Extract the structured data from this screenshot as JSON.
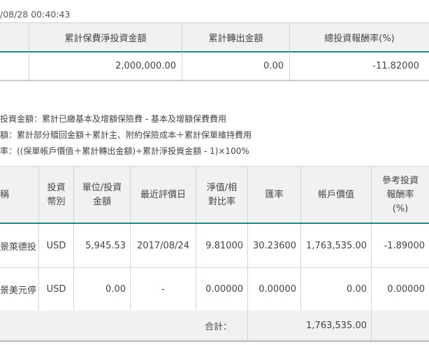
{
  "timestamp": "/08/28 00:40:43",
  "summary": {
    "headers": [
      "",
      "累計保費淨投資金額",
      "累計轉出金額",
      "總投資報酬率(%)"
    ],
    "values": [
      "",
      "2,000,000.00",
      "0.00",
      "-11.82000"
    ]
  },
  "notes": [
    "投資金額：累計已繳基本及增額保險費 - 基本及增額保費費用",
    "額：累計部分贖回金額＋累計主、附約保險成本＋累計保單維持費用",
    "率：((保單帳戶價值＋累計轉出金額)÷累計淨投資金額 - 1)×100%"
  ],
  "detail": {
    "headers": [
      "稱",
      "投資\n幣別",
      "單位/投資\n金額",
      "最近評價日",
      "淨值/相\n對比率",
      "匯率",
      "帳戶價值",
      "參考投資\n報酬率\n(%)"
    ],
    "rows": [
      [
        "景萊德投",
        "USD",
        "5,945.53",
        "2017/08/24",
        "9.81000",
        "30.23600",
        "1,763,535.00",
        "-1.89000"
      ],
      [
        "景美元停",
        "USD",
        "0.00",
        "-",
        "0.00000",
        "0.00000",
        "0.00",
        "0.00000"
      ]
    ],
    "total_label": "合計：",
    "total_value": "1,763,535.00"
  }
}
